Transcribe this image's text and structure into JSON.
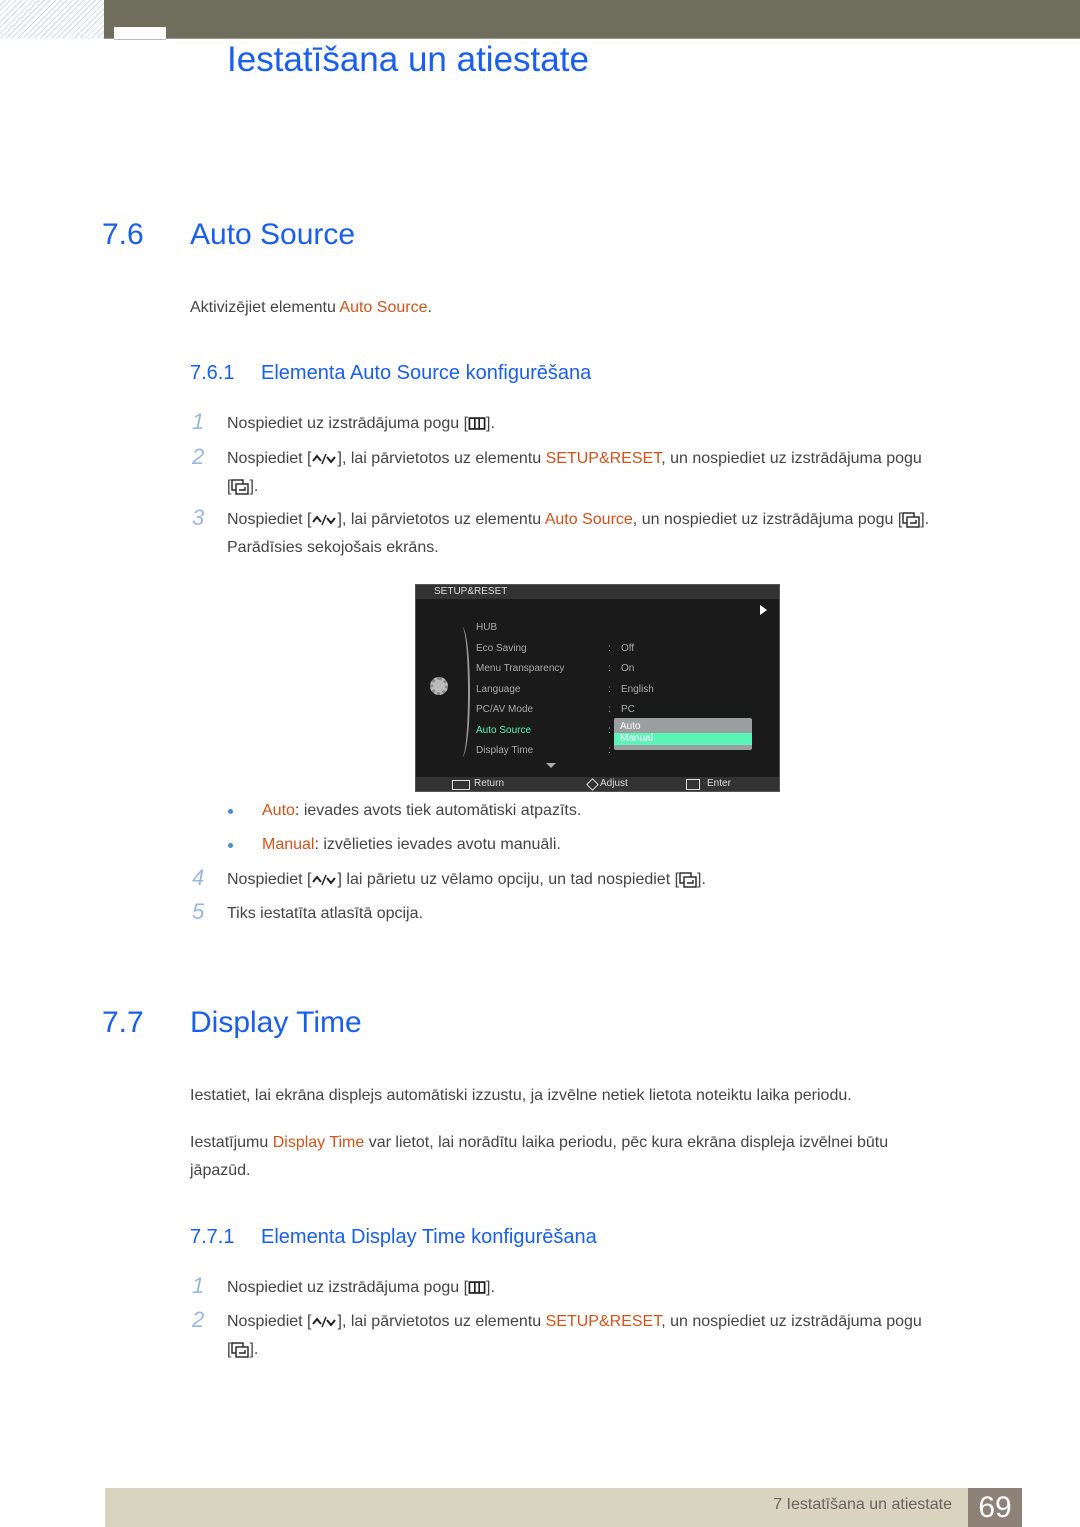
{
  "header": {
    "chapter_title": "Iestatīšana un atiestate"
  },
  "section_76": {
    "number": "7.6",
    "title": "Auto Source",
    "intro_prefix": "Aktivizējiet elementu ",
    "intro_link": "Auto Source",
    "intro_suffix": ".",
    "sub": {
      "number": "7.6.1",
      "title": "Elementa Auto Source konfigurēšana"
    },
    "steps": [
      {
        "n": "1",
        "a": "Nospiediet uz izstrādājuma pogu [",
        "b": "]."
      },
      {
        "n": "2",
        "a": "Nospiediet [",
        "b": "], lai pārvietotos uz elementu ",
        "hl": "SETUP&RESET",
        "c": ", un nospiediet uz izstrādājuma pogu",
        "d": "[",
        "e": "]."
      },
      {
        "n": "3",
        "a": "Nospiediet [",
        "b": "], lai pārvietotos uz elementu ",
        "hl": "Auto Source",
        "c": ", un nospiediet uz izstrādājuma pogu [",
        "d": "].",
        "e": "Parādīsies sekojošais ekrāns."
      },
      {
        "n": "4",
        "a": "Nospiediet [",
        "b": "] lai pārietu uz vēlamo opciju, un tad nospiediet [",
        "c": "]."
      },
      {
        "n": "5",
        "a": "Tiks iestatīta atlasītā opcija."
      }
    ],
    "bullets": [
      {
        "hl": "Auto",
        "text": ": ievades avots tiek automātiski atpazīts."
      },
      {
        "hl": "Manual",
        "text": ": izvēlieties ievades avotu manuāli."
      }
    ]
  },
  "osd": {
    "title": "SETUP&RESET",
    "items": [
      {
        "label": "HUB",
        "value": ""
      },
      {
        "label": "Eco Saving",
        "value": "Off"
      },
      {
        "label": "Menu Transparency",
        "value": "On"
      },
      {
        "label": "Language",
        "value": "English"
      },
      {
        "label": "PC/AV Mode",
        "value": "PC"
      },
      {
        "label": "Auto Source",
        "value": ""
      },
      {
        "label": "Display Time",
        "value": ""
      }
    ],
    "dropdown": [
      "Auto",
      "Manual"
    ],
    "selected": "Manual",
    "footer": {
      "return": "Return",
      "adjust": "Adjust",
      "enter": "Enter"
    },
    "colors": {
      "active": "#5cf5b8"
    }
  },
  "section_77": {
    "number": "7.7",
    "title": "Display Time",
    "p1": "Iestatiet, lai ekrāna displejs automātiski izzustu, ja izvēlne netiek lietota noteiktu laika periodu.",
    "p2_prefix": "Iestatījumu ",
    "p2_link": "Display Time",
    "p2_suffix": " var lietot, lai norādītu laika periodu, pēc kura ekrāna displeja izvēlnei būtu",
    "p2_line2": "jāpazūd.",
    "sub": {
      "number": "7.7.1",
      "title": "Elementa Display Time konfigurēšana"
    },
    "steps": [
      {
        "n": "1",
        "a": "Nospiediet uz izstrādājuma pogu [",
        "b": "]."
      },
      {
        "n": "2",
        "a": "Nospiediet [",
        "b": "], lai pārvietotos uz elementu ",
        "hl": "SETUP&RESET",
        "c": ", un nospiediet uz izstrādājuma pogu",
        "d": "[",
        "e": "]."
      }
    ]
  },
  "footer": {
    "text": "7 Iestatīšana un atiestate",
    "page": "69"
  }
}
